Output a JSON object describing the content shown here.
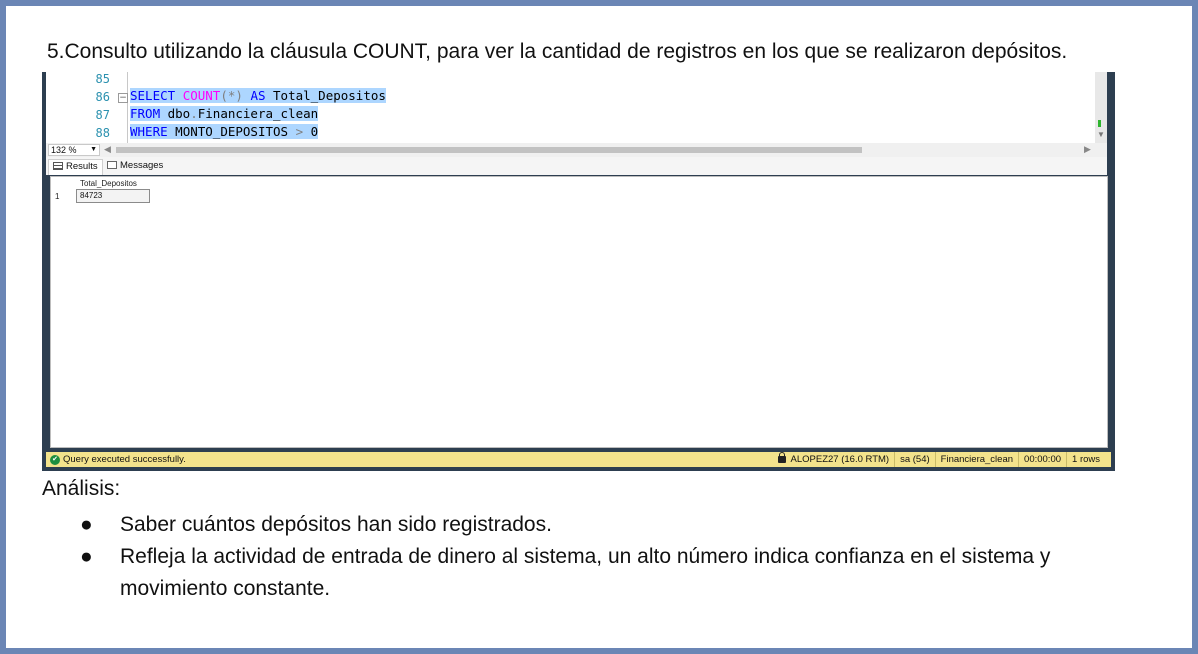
{
  "heading": "5.Consulto utilizando la cláusula COUNT, para ver la cantidad de registros en los que se realizaron depósitos.",
  "editor": {
    "line_numbers": [
      "85",
      "86",
      "87",
      "88"
    ],
    "fold_glyph": "−",
    "lines": [
      {
        "tokens": []
      },
      {
        "tokens": [
          {
            "t": "SELECT",
            "c": "kw"
          },
          {
            "t": " ",
            "c": "id"
          },
          {
            "t": "COUNT",
            "c": "fn"
          },
          {
            "t": "(*)",
            "c": "op"
          },
          {
            "t": " ",
            "c": "id"
          },
          {
            "t": "AS",
            "c": "kw"
          },
          {
            "t": " Total_Depositos",
            "c": "id"
          }
        ]
      },
      {
        "tokens": [
          {
            "t": "FROM",
            "c": "kw"
          },
          {
            "t": " dbo",
            "c": "id"
          },
          {
            "t": ".",
            "c": "op"
          },
          {
            "t": "Financiera_clean",
            "c": "id"
          }
        ]
      },
      {
        "tokens": [
          {
            "t": "WHERE",
            "c": "kw"
          },
          {
            "t": " MONTO_DEPOSITOS ",
            "c": "id"
          },
          {
            "t": ">",
            "c": "op"
          },
          {
            "t": " 0",
            "c": "id"
          }
        ]
      }
    ],
    "zoom_level": "132 %"
  },
  "tabs": {
    "results_label": "Results",
    "messages_label": "Messages"
  },
  "results": {
    "column_header": "Total_Depositos",
    "row_number": "1",
    "value": "84723"
  },
  "status": {
    "message": "Query executed successfully.",
    "server": "ALOPEZ27 (16.0 RTM)",
    "user": "sa (54)",
    "database": "Financiera_clean",
    "elapsed": "00:00:00",
    "rows": "1 rows"
  },
  "analysis": {
    "title": "Análisis:",
    "bullet_glyph": "●",
    "items": [
      "Saber cuántos depósitos han sido registrados.",
      "Refleja la actividad de entrada de dinero al sistema, un alto número indica confianza en el sistema y movimiento constante."
    ]
  }
}
